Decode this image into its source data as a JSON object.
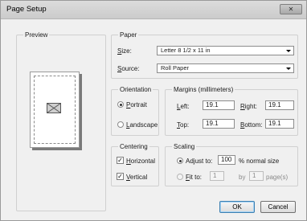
{
  "window": {
    "title": "Page Setup",
    "close_glyph": "✕"
  },
  "preview": {
    "legend": "Preview",
    "icon": "image-placeholder-icon"
  },
  "paper": {
    "legend": "Paper",
    "size_label_accel": "S",
    "size_label_rest": "ize:",
    "size_value": "Letter 8 1/2 x 11 in",
    "source_label_accel": "S",
    "source_label_rest": "ource:",
    "source_value": "Roll Paper"
  },
  "orientation": {
    "legend": "Orientation",
    "portrait_accel": "P",
    "portrait_rest": "ortrait",
    "landscape_accel": "L",
    "landscape_rest": "andscape",
    "selected": "Portrait"
  },
  "margins": {
    "legend": "Margins (millimeters)",
    "left_accel": "L",
    "left_rest": "eft:",
    "left_value": "19.1",
    "right_accel": "R",
    "right_rest": "ight:",
    "right_value": "19.1",
    "top_accel": "T",
    "top_rest": "op:",
    "top_value": "19.1",
    "bottom_accel": "B",
    "bottom_rest": "ottom:",
    "bottom_value": "19.1"
  },
  "centering": {
    "legend": "Centering",
    "horizontal_accel": "H",
    "horizontal_rest": "orizontal",
    "horizontal_checked": true,
    "vertical_accel": "V",
    "vertical_rest": "ertical",
    "vertical_checked": true,
    "check_glyph": "✓"
  },
  "scaling": {
    "legend": "Scaling",
    "adjust_pre": "Ad",
    "adjust_accel": "j",
    "adjust_rest": "ust to:",
    "adjust_value": "100",
    "adjust_suffix": "% normal size",
    "fit_accel": "F",
    "fit_rest": "it to:",
    "fit_wide_value": "1",
    "fit_by": "by",
    "fit_tall_value": "1",
    "fit_suffix": "page(s)",
    "selected": "Adjust to"
  },
  "buttons": {
    "ok": "OK",
    "cancel": "Cancel"
  },
  "colors": {
    "dialog_bg": "#f0f0f0",
    "default_button_border": "#3c7fb1"
  }
}
